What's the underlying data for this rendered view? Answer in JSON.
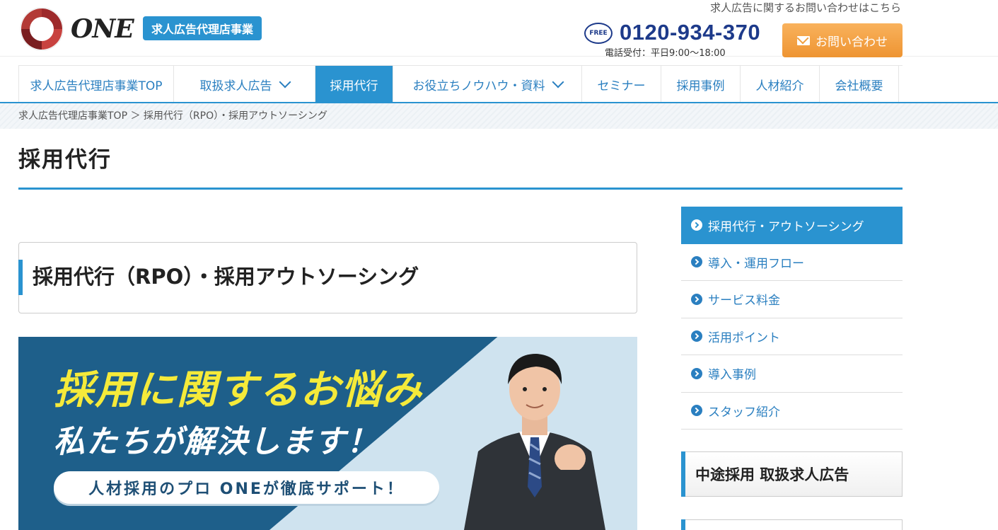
{
  "header": {
    "logo_text": "ONE",
    "badge": "求人広告代理店事業",
    "contact_title": "求人広告に関するお問い合わせはこちら",
    "freecall_label": "フリーコール",
    "phone": "0120-934-370",
    "hours": "電話受付：平日9:00〜18:00",
    "contact_button": "お問い合わせ"
  },
  "nav": {
    "items": [
      {
        "label": "求人広告代理店事業TOP"
      },
      {
        "label": "取扱求人広告"
      },
      {
        "label": "採用代行"
      },
      {
        "label": "お役立ちノウハウ・資料"
      },
      {
        "label": "セミナー"
      },
      {
        "label": "採用事例"
      },
      {
        "label": "人材紹介"
      },
      {
        "label": "会社概要"
      }
    ]
  },
  "breadcrumb": "求人広告代理店事業TOP ＞ 採用代行（RPO）・採用アウトソーシング",
  "page_title": "採用代行",
  "section_title": "採用代行（RPO）・採用アウトソーシング",
  "banner": {
    "headline": "採用に関するお悩み",
    "subheadline": "私たちが解決します！",
    "pill": "人材採用のプロ ONEが徹底サポート！"
  },
  "sidebar": {
    "items": [
      {
        "label": "採用代行・アウトソーシング"
      },
      {
        "label": "導入・運用フロー"
      },
      {
        "label": "サービス料金"
      },
      {
        "label": "活用ポイント"
      },
      {
        "label": "導入事例"
      },
      {
        "label": "スタッフ紹介"
      }
    ],
    "box_title": "中途採用 取扱求人広告"
  },
  "colors": {
    "accent": "#2a93d0",
    "phone": "#1d3a8a",
    "cta": "#ee9432"
  }
}
